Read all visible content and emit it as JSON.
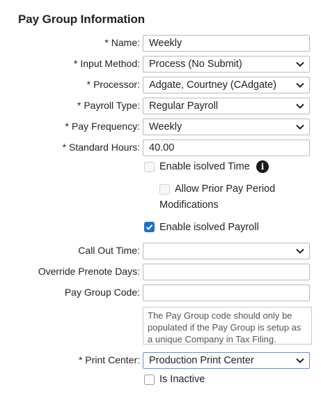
{
  "section_title": "Pay Group Information",
  "required_marker": "*",
  "fields": {
    "name": {
      "label": "Name:",
      "value": "Weekly",
      "required": true
    },
    "input_method": {
      "label": "Input Method:",
      "value": "Process (No Submit)",
      "required": true
    },
    "processor": {
      "label": "Processor:",
      "value": "Adgate, Courtney (CAdgate)",
      "required": true
    },
    "payroll_type": {
      "label": "Payroll Type:",
      "value": "Regular Payroll",
      "required": true
    },
    "pay_frequency": {
      "label": "Pay Frequency:",
      "value": "Weekly",
      "required": true
    },
    "standard_hours": {
      "label": "Standard Hours:",
      "value": "40.00",
      "required": true
    },
    "call_out_time": {
      "label": "Call Out Time:",
      "value": ""
    },
    "override_prenote_days": {
      "label": "Override Prenote Days:",
      "value": ""
    },
    "pay_group_code": {
      "label": "Pay Group Code:",
      "value": ""
    },
    "print_center": {
      "label": "Print Center:",
      "value": "Production Print Center",
      "required": true
    }
  },
  "checkboxes": {
    "enable_isolved_time": {
      "label": "Enable isolved Time",
      "checked": false,
      "disabled": true
    },
    "allow_prior_pay_period_line1": "Allow Prior Pay Period",
    "allow_prior_pay_period_line2": "Modifications",
    "allow_prior_pay_period": {
      "checked": false,
      "disabled": true
    },
    "enable_isolved_payroll": {
      "label": "Enable isolved Payroll",
      "checked": true
    },
    "is_inactive": {
      "label": "Is Inactive",
      "checked": false
    }
  },
  "info_icon_glyph": "i",
  "pay_group_code_note": {
    "line1": "The Pay Group code should only be",
    "line2": "populated if the Pay Group is setup as",
    "line3": "a unique Company in Tax Filing."
  },
  "colors": {
    "checkbox_checked": "#1f6fd0",
    "focused_border": "#6a8fc4"
  }
}
